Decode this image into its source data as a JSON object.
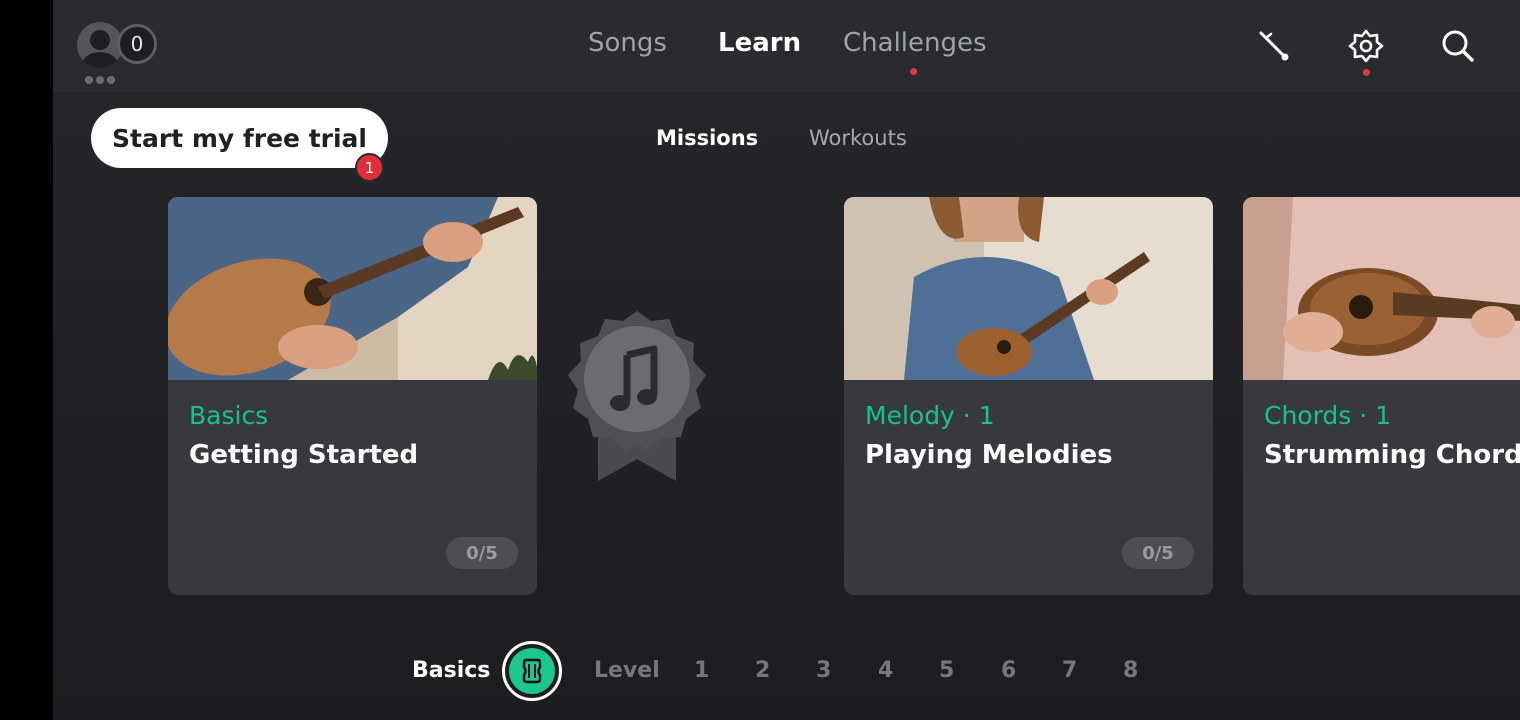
{
  "header": {
    "coins": "0",
    "nav_tabs": [
      "Songs",
      "Learn",
      "Challenges"
    ],
    "active_tab": "Learn",
    "icons": [
      "tuner-icon",
      "gear-icon",
      "search-icon"
    ]
  },
  "trial": {
    "label": "Start my free trial",
    "badge": "1"
  },
  "sub_tabs": [
    "Missions",
    "Workouts"
  ],
  "cards": [
    {
      "category": "Basics",
      "title": "Getting Started",
      "progress": "0/5"
    },
    {
      "category": "Melody · 1",
      "title": "Playing Melodies",
      "progress": "0/5"
    },
    {
      "category": "Chords · 1",
      "title": "Strumming Chords"
    }
  ],
  "levels": {
    "current": "Basics",
    "level_label": "Level",
    "numbers": [
      "1",
      "2",
      "3",
      "4",
      "5",
      "6",
      "7",
      "8"
    ]
  },
  "colors": {
    "accent": "#17c38b",
    "notification": "#e23b3b",
    "card_bg": "#38393e",
    "header_bg": "#2a2b2f"
  }
}
